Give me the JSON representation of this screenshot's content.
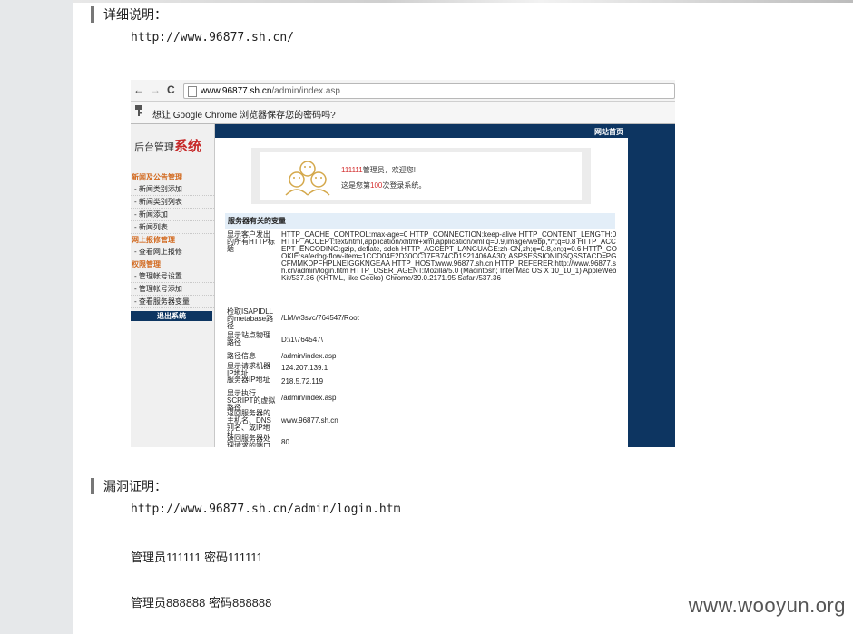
{
  "sections": {
    "detail": {
      "heading": "详细说明：",
      "url": "http://www.96877.sh.cn/"
    },
    "proof": {
      "heading": "漏洞证明：",
      "url": "http://www.96877.sh.cn/admin/login.htm",
      "credential_1": "管理员111111 密码111111",
      "credential_2": "管理员888888 密码888888"
    }
  },
  "watermark": "www.wooyun.org",
  "screenshot": {
    "browser": {
      "back_icon": "←",
      "forward_icon": "→",
      "reload_icon": "C",
      "address_host": "www.96877.sh.cn",
      "address_path": "/admin/index.asp",
      "infobar_text": "想让 Google Chrome 浏览器保存您的密码吗?"
    },
    "admin": {
      "logo_prefix": "后台管理",
      "logo_emph": "系统",
      "top_link": "网站首页",
      "menu": [
        {
          "type": "group",
          "label": "新闻及公告管理"
        },
        {
          "type": "item",
          "label": "- 新闻类别添加"
        },
        {
          "type": "item",
          "label": "- 新闻类别列表"
        },
        {
          "type": "item",
          "label": "- 新闻添加"
        },
        {
          "type": "item",
          "label": "- 新闻列表"
        },
        {
          "type": "group",
          "label": "网上报修管理"
        },
        {
          "type": "item",
          "label": "- 查看网上报修"
        },
        {
          "type": "group",
          "label": "权限管理"
        },
        {
          "type": "item",
          "label": "- 管理帐号设置"
        },
        {
          "type": "item",
          "label": "- 管理帐号添加"
        },
        {
          "type": "item",
          "label": "- 查看服务器变量"
        }
      ],
      "logout_label": "退出系统",
      "welcome": {
        "user": "111111",
        "line1_suffix": "管理员，欢迎您!",
        "line2_prefix": "这是您第",
        "count": "100",
        "line2_suffix": "次登录系统。"
      },
      "vars_heading": "服务器有关的变量",
      "vars": [
        {
          "key": "显示客户发出的所有HTTP标题",
          "value": "HTTP_CACHE_CONTROL:max-age=0 HTTP_CONNECTION:keep-alive HTTP_CONTENT_LENGTH:0 HTTP_ACCEPT:text/html,application/xhtml+xml,application/xml;q=0.9,image/webp,*/*;q=0.8 HTTP_ACCEPT_ENCODING:gzip, deflate, sdch HTTP_ACCEPT_LANGUAGE:zh-CN,zh;q=0.8,en;q=0.6 HTTP_COOKIE:safedog-flow-item=1CCD04E2D30CC17FB74CD1921406AA30; ASPSESSIONIDSQSSTACD=PGCFMMKDPFHPLNEIGGKNGEAA HTTP_HOST:www.96877.sh.cn HTTP_REFERER:http://www.96877.sh.cn/admin/login.htm HTTP_USER_AGENT:Mozilla/5.0 (Macintosh; Intel Mac OS X 10_10_1) AppleWebKit/537.36 (KHTML, like Gecko) Chrome/39.0.2171.95 Safari/537.36"
        },
        {
          "key": "检取ISAPIDLL的metabase路径",
          "value": "/LM/w3svc/764547/Root"
        },
        {
          "key": "显示站点物理路径",
          "value": "D:\\1\\764547\\"
        },
        {
          "key": "路径信息",
          "value": "/admin/index.asp"
        },
        {
          "key": "显示请求机器IP地址",
          "value": "124.207.139.1"
        },
        {
          "key": "服务器IP地址",
          "value": "218.5.72.119"
        },
        {
          "key": "显示执行SCRIPT的虚拟路径",
          "value": "/admin/index.asp"
        },
        {
          "key": "返回服务器的主机名、DNS别名、或IP地址",
          "value": "www.96877.sh.cn"
        },
        {
          "key": "返回服务器处理请求的端口",
          "value": "80"
        }
      ]
    }
  }
}
